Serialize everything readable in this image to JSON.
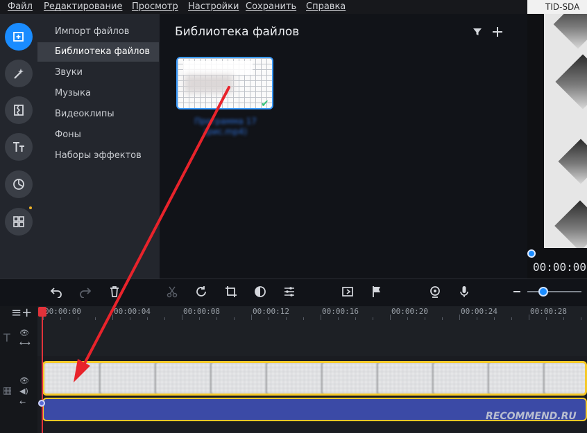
{
  "menu": {
    "items": [
      "Файл",
      "Редактирование",
      "Просмотр",
      "Настройки",
      "Сохранить",
      "Справка"
    ],
    "watermark": "TID-SDA"
  },
  "rail": {
    "icons": [
      "import-icon",
      "magic-wand-icon",
      "transitions-icon",
      "titles-icon",
      "stickers-icon",
      "more-tools-icon"
    ]
  },
  "categories": [
    "Импорт файлов",
    "Библиотека файлов",
    "Звуки",
    "Музыка",
    "Видеоклипы",
    "Фоны",
    "Наборы эффектов"
  ],
  "selected_category": "Библиотека файлов",
  "library": {
    "title": "Библиотека файлов",
    "file_caption": "Программа 17 (рис.mp4)"
  },
  "preview": {
    "time": "00:00:00"
  },
  "timeline": {
    "ticks": [
      "00:00:00",
      "00:00:04",
      "00:00:08",
      "00:00:12",
      "00:00:16",
      "00:00:20",
      "00:00:24",
      "00:00:28"
    ],
    "zoom_level": 0.3
  },
  "colors": {
    "accent": "#1a8cff",
    "clip_border": "#f5c92a",
    "audio": "#3b4aa6",
    "playhead": "#e2323a",
    "annotation_arrow": "#e8232b"
  },
  "watermark_bottom": "RECOMMEND.RU"
}
